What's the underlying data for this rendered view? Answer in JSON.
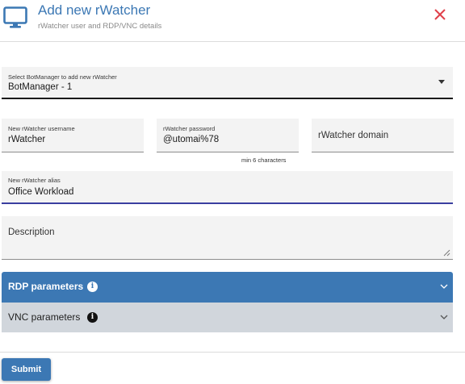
{
  "header": {
    "title": "Add new rWatcher",
    "subtitle": "rWatcher user and RDP/VNC details",
    "icon": "monitor-icon",
    "close_icon": "close-icon",
    "close_color": "#e0404a"
  },
  "form": {
    "botmanager": {
      "label": "Select BotManager to add new rWatcher",
      "value": "BotManager - 1"
    },
    "username": {
      "label": "New rWatcher username",
      "value": "rWatcher"
    },
    "password": {
      "label": "rWatcher password",
      "value": "@utomai%78",
      "hint": "min 6 characters"
    },
    "domain": {
      "placeholder": "rWatcher domain"
    },
    "alias": {
      "label": "New rWatcher alias",
      "value": "Office Workload"
    },
    "description": {
      "placeholder": "Description"
    }
  },
  "panels": {
    "rdp": {
      "label": "RDP parameters",
      "info_icon": "i"
    },
    "vnc": {
      "label": "VNC parameters",
      "info_icon": "i"
    }
  },
  "footer": {
    "submit_label": "Submit"
  },
  "colors": {
    "accent": "#3c78b4",
    "panel_secondary": "#d1d6dc",
    "field_bg": "#f3f3f3",
    "focus_underline": "#3a3fa0"
  }
}
